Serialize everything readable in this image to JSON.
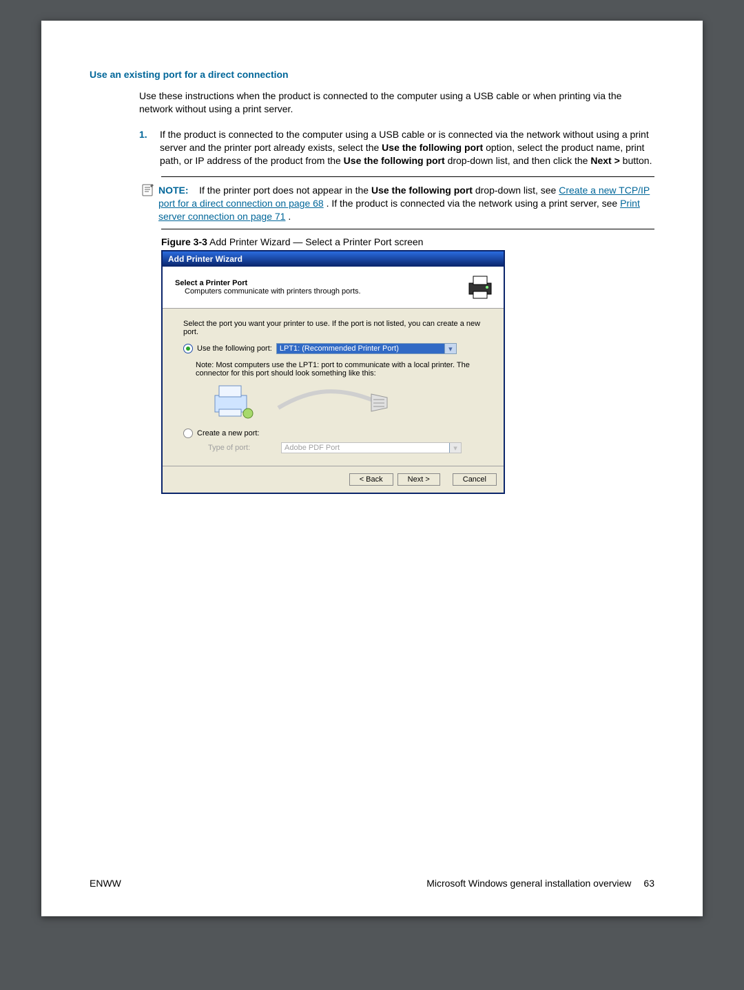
{
  "section": {
    "heading": "Use an existing port for a direct connection",
    "intro": "Use these instructions when the product is connected to the computer using a USB cable or when printing via the network without using a print server.",
    "step1_num": "1.",
    "step1_a": "If the product is connected to the computer using a USB cable or is connected via the network without using a print server and the printer port already exists, select the ",
    "step1_bold1": "Use the following port",
    "step1_b": " option, select the product name, print path, or IP address of the product from the ",
    "step1_bold2": "Use the following port",
    "step1_c": " drop-down list, and then click the ",
    "step1_bold3": "Next >",
    "step1_d": " button."
  },
  "note": {
    "label": "NOTE:",
    "a": "If the printer port does not appear in the ",
    "bold": "Use the following port",
    "b": " drop-down list, see ",
    "link1": "Create a new TCP/IP port for a direct connection on page 68",
    "c": ". If the product is connected via the network using a print server, see ",
    "link2": "Print server connection on page 71",
    "d": "."
  },
  "figure": {
    "label": "Figure 3-3",
    "caption": "  Add Printer Wizard — Select a Printer Port screen"
  },
  "wizard": {
    "title": "Add Printer Wizard",
    "header_title": "Select a Printer Port",
    "header_sub": "Computers communicate with printers through ports.",
    "body_intro": "Select the port you want your printer to use.  If the port is not listed, you can create a new port.",
    "radio_use_label": "Use the following port:",
    "dd_use_value": "LPT1: (Recommended Printer Port)",
    "port_note": "Note: Most computers use the LPT1: port to communicate with a local printer. The connector for this port should look something like this:",
    "radio_create_label": "Create a new port:",
    "type_label": "Type of port:",
    "dd_create_value": "Adobe PDF Port",
    "btn_back": "< Back",
    "btn_next": "Next >",
    "btn_cancel": "Cancel"
  },
  "footer": {
    "left": "ENWW",
    "right_text": "Microsoft Windows general installation overview",
    "page": "63"
  }
}
